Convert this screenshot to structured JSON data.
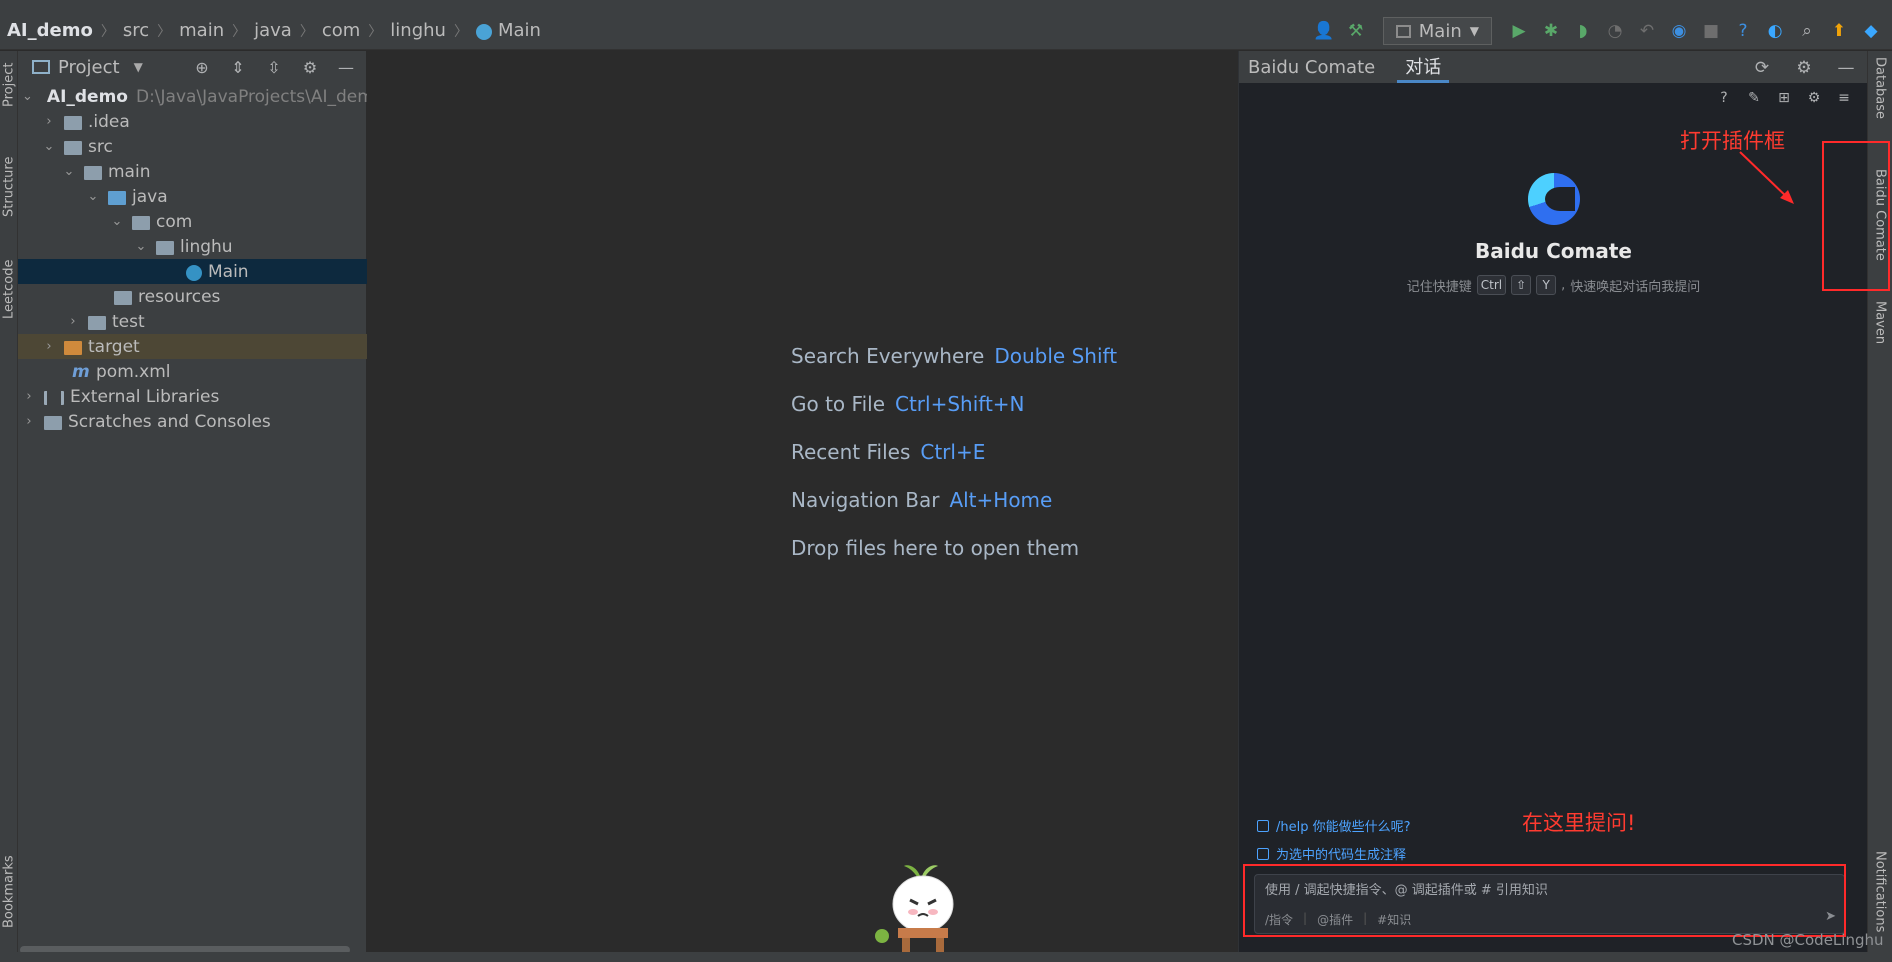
{
  "navbar": {
    "breadcrumbs": [
      "AI_demo",
      "src",
      "main",
      "java",
      "com",
      "linghu",
      "Main"
    ],
    "run_config": "Main"
  },
  "left_strip": {
    "tabs": [
      "Project",
      "Structure",
      "Leetcode",
      "Bookmarks"
    ]
  },
  "project_panel": {
    "title": "Project",
    "tree": [
      {
        "label": "AI_demo",
        "path": "D:\\Java\\JavaProjects\\AI_dem"
      },
      {
        "label": ".idea"
      },
      {
        "label": "src"
      },
      {
        "label": "main"
      },
      {
        "label": "java"
      },
      {
        "label": "com"
      },
      {
        "label": "linghu"
      },
      {
        "label": "Main"
      },
      {
        "label": "resources"
      },
      {
        "label": "test"
      },
      {
        "label": "target"
      },
      {
        "label": "pom.xml"
      },
      {
        "label": "External Libraries"
      },
      {
        "label": "Scratches and Consoles"
      }
    ]
  },
  "editor": {
    "hints": [
      {
        "label": "Search Everywhere",
        "key": "Double Shift"
      },
      {
        "label": "Go to File",
        "key": "Ctrl+Shift+N"
      },
      {
        "label": "Recent Files",
        "key": "Ctrl+E"
      },
      {
        "label": "Navigation Bar",
        "key": "Alt+Home"
      },
      {
        "label": "Drop files here to open them",
        "key": ""
      }
    ]
  },
  "comate": {
    "tabs": [
      "Baidu Comate",
      "对话"
    ],
    "active_tab": "对话",
    "title": "Baidu Comate",
    "shortcut_prefix": "记住快捷键",
    "shortcut_keys": [
      "Ctrl",
      "⇧",
      "Y"
    ],
    "shortcut_suffix": "快速唤起对话向我提问",
    "suggestions": [
      "/help 你能做些什么呢?",
      "为选中的代码生成注释"
    ],
    "input_placeholder": "使用 / 调起快捷指令、@ 调起插件或 # 引用知识",
    "input_tags": [
      "/指令",
      "@插件",
      "#知识"
    ]
  },
  "right_strip": {
    "tabs": [
      "Database",
      "Baidu Comate",
      "Maven",
      "Notifications"
    ]
  },
  "annotations": {
    "open_plugin": "打开插件框",
    "ask_here": "在这里提问!"
  },
  "watermark": "CSDN @CodeLinghu",
  "colors": {
    "accent": "#589df6",
    "annotation": "#ff2a2a",
    "selected_row": "#0d293e"
  }
}
